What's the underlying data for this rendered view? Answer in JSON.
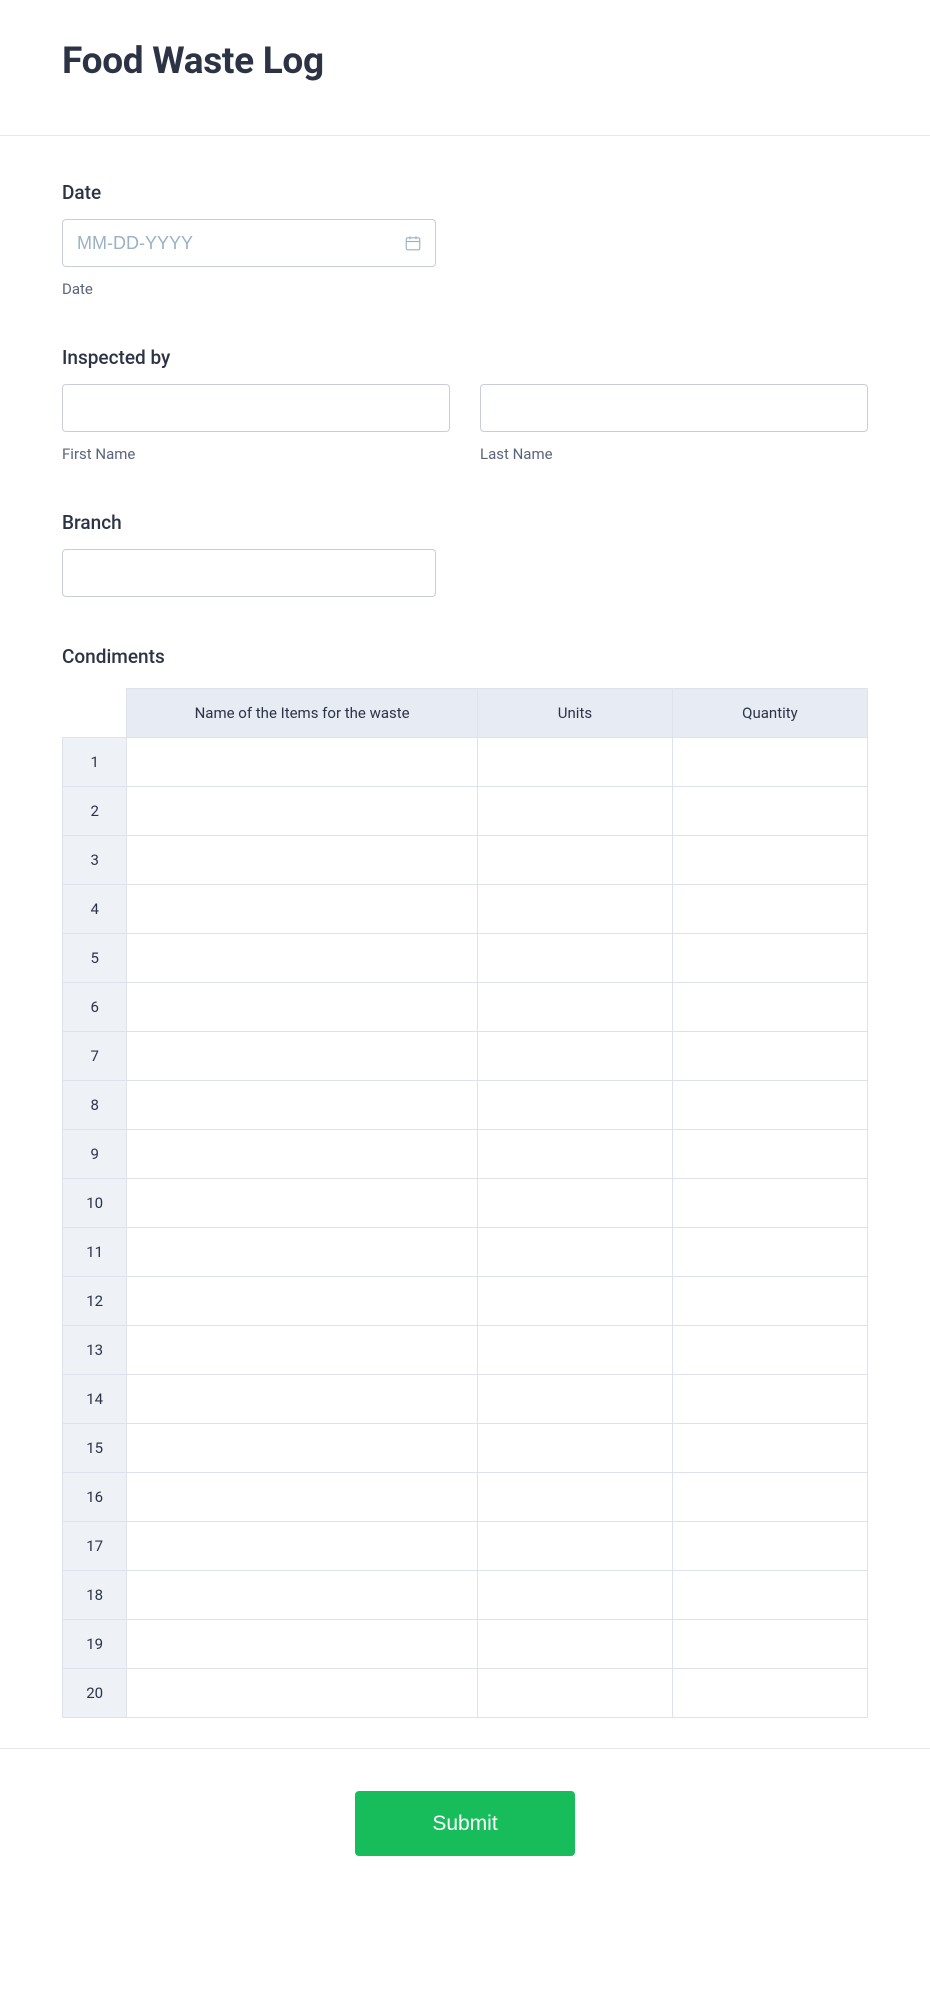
{
  "header": {
    "title": "Food Waste Log"
  },
  "date_field": {
    "label": "Date",
    "placeholder": "MM-DD-YYYY",
    "value": "",
    "sublabel": "Date"
  },
  "inspected_by": {
    "label": "Inspected by",
    "first_name": {
      "value": "",
      "sublabel": "First Name"
    },
    "last_name": {
      "value": "",
      "sublabel": "Last Name"
    }
  },
  "branch": {
    "label": "Branch",
    "value": ""
  },
  "condiments": {
    "label": "Condiments",
    "columns": {
      "name": "Name of the Items for the waste",
      "units": "Units",
      "quantity": "Quantity"
    },
    "rows": [
      {
        "n": "1",
        "name": "",
        "units": "",
        "quantity": ""
      },
      {
        "n": "2",
        "name": "",
        "units": "",
        "quantity": ""
      },
      {
        "n": "3",
        "name": "",
        "units": "",
        "quantity": ""
      },
      {
        "n": "4",
        "name": "",
        "units": "",
        "quantity": ""
      },
      {
        "n": "5",
        "name": "",
        "units": "",
        "quantity": ""
      },
      {
        "n": "6",
        "name": "",
        "units": "",
        "quantity": ""
      },
      {
        "n": "7",
        "name": "",
        "units": "",
        "quantity": ""
      },
      {
        "n": "8",
        "name": "",
        "units": "",
        "quantity": ""
      },
      {
        "n": "9",
        "name": "",
        "units": "",
        "quantity": ""
      },
      {
        "n": "10",
        "name": "",
        "units": "",
        "quantity": ""
      },
      {
        "n": "11",
        "name": "",
        "units": "",
        "quantity": ""
      },
      {
        "n": "12",
        "name": "",
        "units": "",
        "quantity": ""
      },
      {
        "n": "13",
        "name": "",
        "units": "",
        "quantity": ""
      },
      {
        "n": "14",
        "name": "",
        "units": "",
        "quantity": ""
      },
      {
        "n": "15",
        "name": "",
        "units": "",
        "quantity": ""
      },
      {
        "n": "16",
        "name": "",
        "units": "",
        "quantity": ""
      },
      {
        "n": "17",
        "name": "",
        "units": "",
        "quantity": ""
      },
      {
        "n": "18",
        "name": "",
        "units": "",
        "quantity": ""
      },
      {
        "n": "19",
        "name": "",
        "units": "",
        "quantity": ""
      },
      {
        "n": "20",
        "name": "",
        "units": "",
        "quantity": ""
      }
    ]
  },
  "footer": {
    "submit_label": "Submit"
  }
}
